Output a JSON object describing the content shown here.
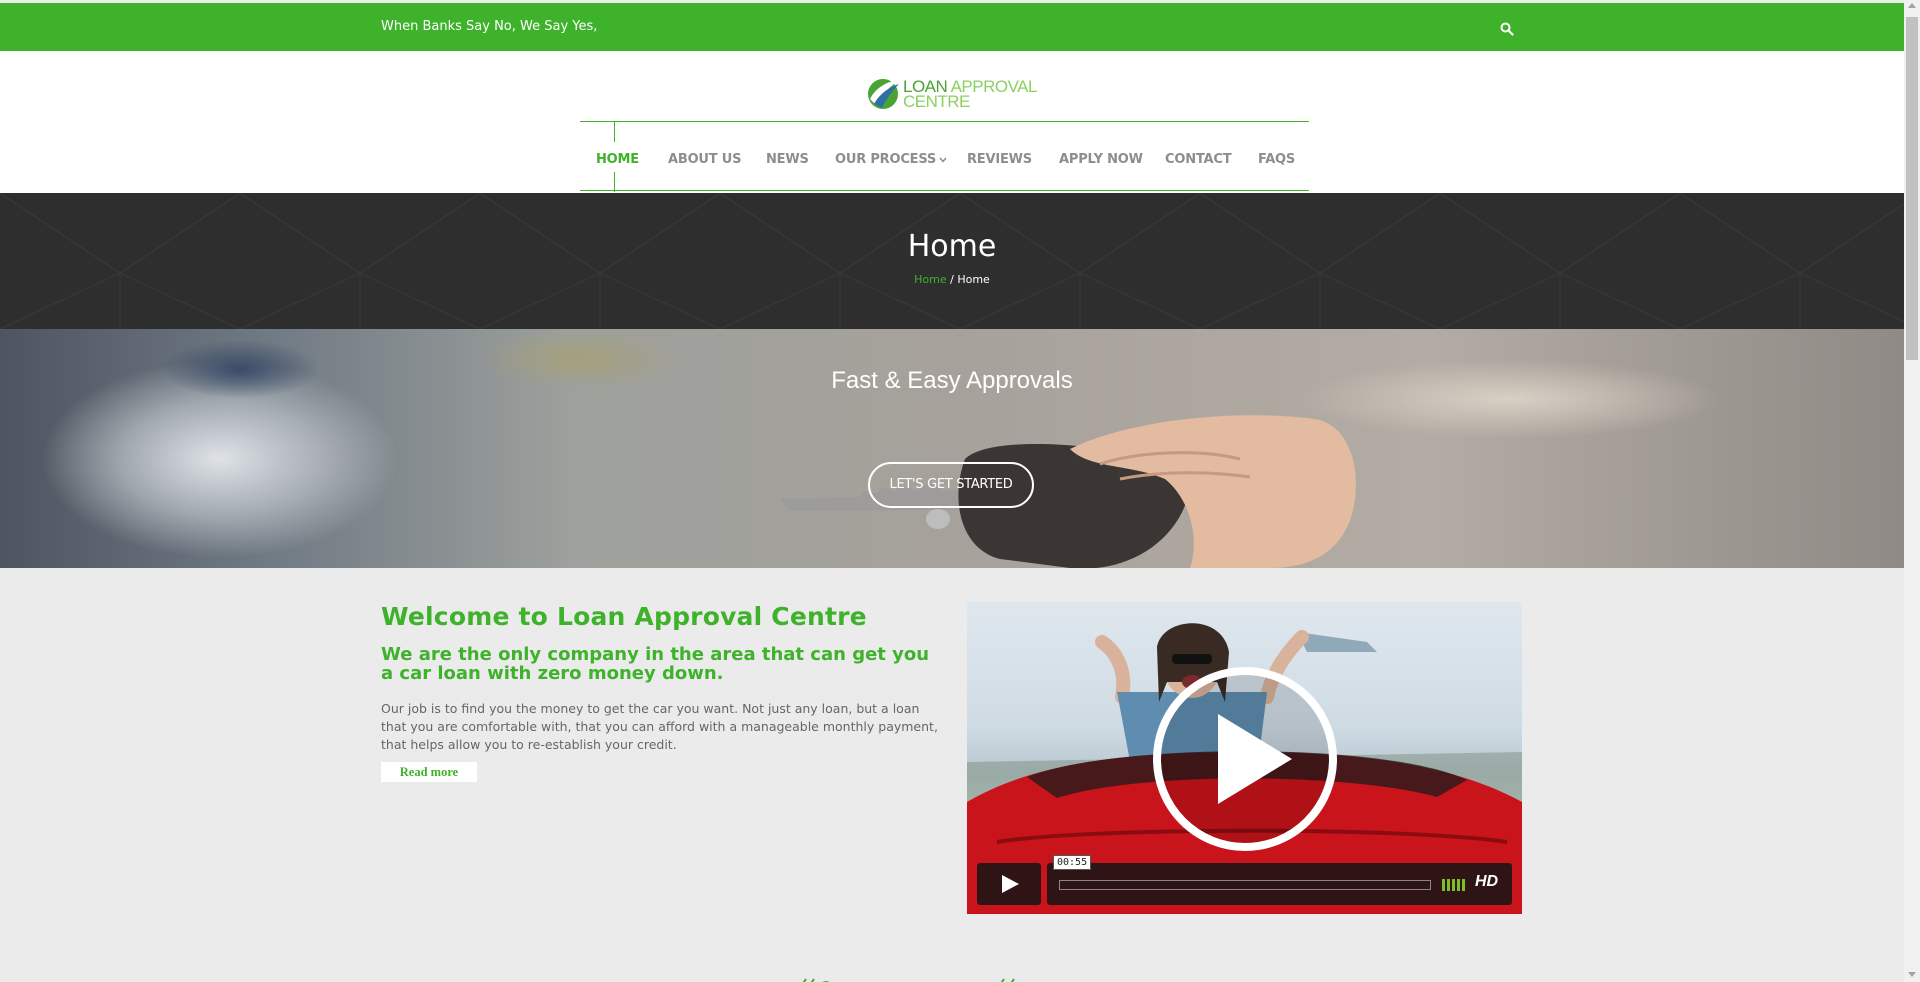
{
  "topbar": {
    "tagline": "When Banks Say No, We Say Yes,",
    "search_icon": "search-icon",
    "bg_color": "#3eb22a"
  },
  "logo": {
    "line1a": "LOAN",
    "line1b": " APPROVAL",
    "line2": "CENTRE"
  },
  "nav": {
    "items": [
      {
        "label": "HOME",
        "active": true
      },
      {
        "label": "ABOUT US"
      },
      {
        "label": "NEWS"
      },
      {
        "label": "OUR PROCESS"
      },
      {
        "label": "REVIEWS"
      },
      {
        "label": "APPLY NOW"
      },
      {
        "label": "CONTACT"
      },
      {
        "label": "FAQS"
      }
    ],
    "dropdown_icon": "chevron-down-icon"
  },
  "page_banner": {
    "title": "Home",
    "breadcrumb_link": "Home",
    "breadcrumb_sep": " / ",
    "breadcrumb_current": "Home"
  },
  "hero": {
    "tagline": "Fast & Easy Approvals",
    "cta": "LET'S GET STARTED"
  },
  "welcome": {
    "title": "Welcome to Loan Approval Centre",
    "subtitle": "We are the only company in the area that can get you a car loan with zero money down.",
    "body": "Our job is to find you the money to get the car you want.  Not just any loan, but a loan that you are comfortable with, that you can afford with a manageable monthly payment, that helps allow you to re-establish your credit.",
    "read_more": "Read more"
  },
  "video": {
    "time": "00:55",
    "hd": "HD",
    "play_icon": "play-icon"
  },
  "colors": {
    "accent": "#3eb22a",
    "banner": "#2e2e2e",
    "text": "#666666"
  }
}
